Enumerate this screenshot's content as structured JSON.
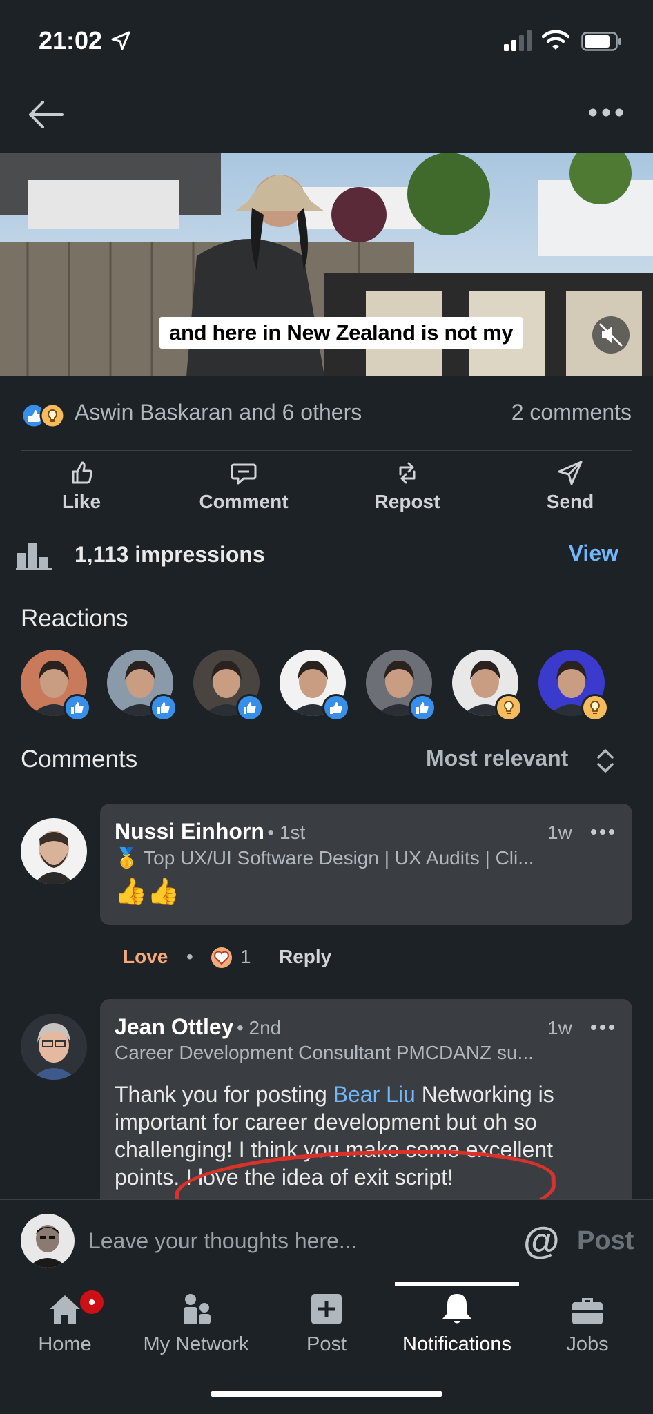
{
  "status_bar": {
    "time": "21:02"
  },
  "video": {
    "caption": "and here in New Zealand is not my"
  },
  "social": {
    "reactors": "Aswin Baskaran and 6 others",
    "comments_count": "2 comments"
  },
  "actions": [
    {
      "label": "Like",
      "icon": "like-icon"
    },
    {
      "label": "Comment",
      "icon": "comment-icon"
    },
    {
      "label": "Repost",
      "icon": "repost-icon"
    },
    {
      "label": "Send",
      "icon": "send-icon"
    }
  ],
  "analytics": {
    "impressions": "1,113 impressions",
    "view_label": "View"
  },
  "reactions": {
    "title": "Reactions",
    "people": [
      {
        "type": "like",
        "color": "#c87a5a"
      },
      {
        "type": "like",
        "color": "#8a9aa8"
      },
      {
        "type": "like",
        "color": "#4a4440"
      },
      {
        "type": "like",
        "color": "#f2f2f2"
      },
      {
        "type": "like",
        "color": "#6c7076"
      },
      {
        "type": "insightful",
        "color": "#e8e8e8"
      },
      {
        "type": "insightful",
        "color": "#3a3acc"
      }
    ]
  },
  "comments": {
    "title": "Comments",
    "sort_label": "Most relevant",
    "items": [
      {
        "name": "Nussi Einhorn",
        "degree": "• 1st",
        "time": "1w",
        "headline": "🥇 Top UX/UI Software Design | UX Audits | Cli...",
        "body": "👍👍"
      },
      {
        "name": "Jean Ottley",
        "degree": "• 2nd",
        "time": "1w",
        "headline": "Career Development Consultant PMCDANZ su...",
        "body_before": "Thank you for posting ",
        "mention": "Bear Liu",
        "body_after": " Networking is important for career development but oh so challenging! I think you make some excellent points. I love the idea of exit script!"
      }
    ],
    "love_label": "Love",
    "love_dot": "•",
    "love_count": "1",
    "reply_label": "Reply"
  },
  "composer": {
    "placeholder": "Leave your thoughts here...",
    "at_symbol": "@",
    "post_label": "Post"
  },
  "tabs": [
    {
      "label": "Home",
      "icon": "home-icon"
    },
    {
      "label": "My Network",
      "icon": "network-icon"
    },
    {
      "label": "Post",
      "icon": "post-icon"
    },
    {
      "label": "Notifications",
      "icon": "bell-icon"
    },
    {
      "label": "Jobs",
      "icon": "briefcase-icon"
    }
  ],
  "colors": {
    "background": "#1d2226",
    "link": "#71b7fb",
    "love": "#f5a97a",
    "notification": "#cc1016",
    "annotation": "#d8322a"
  }
}
